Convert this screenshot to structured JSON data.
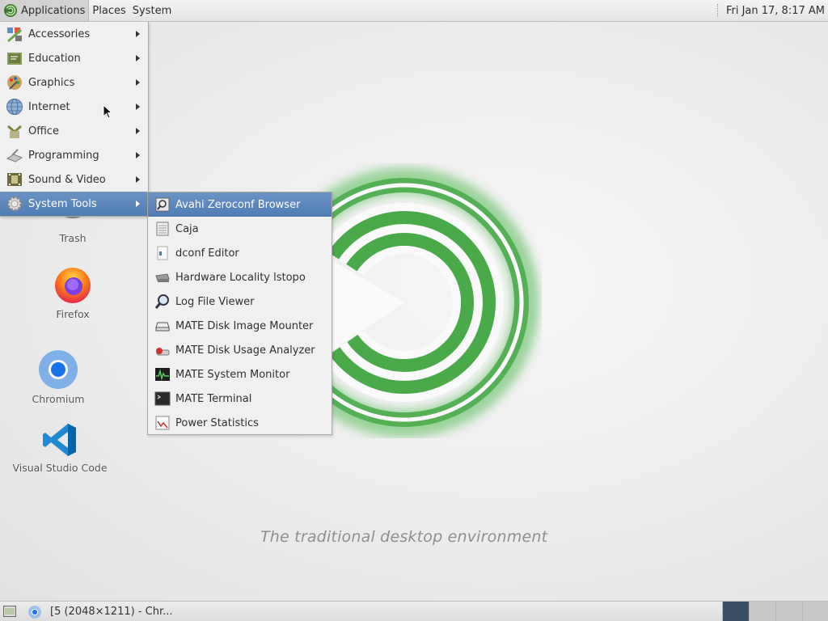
{
  "top_panel": {
    "menus": [
      {
        "label": "Applications"
      },
      {
        "label": "Places"
      },
      {
        "label": "System"
      }
    ],
    "clock": "Fri Jan 17,  8:17 AM"
  },
  "desktop": {
    "tagline": "The traditional desktop environment",
    "icons": [
      {
        "label": "Trash",
        "icon": "trash-icon"
      },
      {
        "label": "Firefox",
        "icon": "firefox-icon"
      },
      {
        "label": "Chromium",
        "icon": "chromium-icon"
      },
      {
        "label": "Visual Studio Code",
        "icon": "vscode-icon"
      }
    ]
  },
  "applications_menu": {
    "items": [
      {
        "label": "Accessories",
        "icon": "accessories-icon"
      },
      {
        "label": "Education",
        "icon": "education-icon"
      },
      {
        "label": "Graphics",
        "icon": "graphics-icon"
      },
      {
        "label": "Internet",
        "icon": "internet-globe-icon"
      },
      {
        "label": "Office",
        "icon": "office-icon"
      },
      {
        "label": "Programming",
        "icon": "programming-icon"
      },
      {
        "label": "Sound & Video",
        "icon": "sound-video-icon"
      },
      {
        "label": "System Tools",
        "icon": "system-tools-gear-icon",
        "highlighted": true
      }
    ]
  },
  "system_tools_submenu": {
    "items": [
      {
        "label": "Avahi Zeroconf Browser",
        "icon": "avahi-icon",
        "highlighted": true
      },
      {
        "label": "Caja",
        "icon": "caja-icon"
      },
      {
        "label": "dconf Editor",
        "icon": "dconf-icon"
      },
      {
        "label": "Hardware Locality lstopo",
        "icon": "hardware-icon"
      },
      {
        "label": "Log File Viewer",
        "icon": "log-viewer-icon"
      },
      {
        "label": "MATE Disk Image Mounter",
        "icon": "disk-mounter-icon"
      },
      {
        "label": "MATE Disk Usage Analyzer",
        "icon": "disk-usage-icon"
      },
      {
        "label": "MATE System Monitor",
        "icon": "system-monitor-icon"
      },
      {
        "label": "MATE Terminal",
        "icon": "terminal-icon"
      },
      {
        "label": "Power Statistics",
        "icon": "power-stats-icon"
      }
    ]
  },
  "bottom_panel": {
    "task_label": "[5 (2048×1211) - Chr...",
    "workspaces": [
      {
        "active": true
      },
      {
        "active": false
      },
      {
        "active": false
      },
      {
        "active": false
      }
    ]
  },
  "colors": {
    "highlight": "#5a86bd",
    "panel": "#e8e8e8",
    "logo_green": "#3fa83f"
  }
}
